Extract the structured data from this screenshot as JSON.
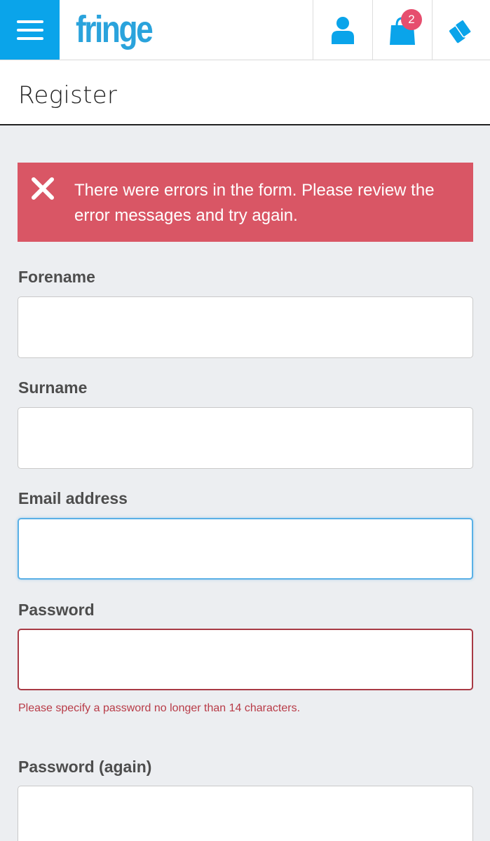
{
  "header": {
    "logo": "fringe",
    "basket_count": "2"
  },
  "icons": {
    "menu": "hamburger-menu-icon",
    "account": "user-icon",
    "basket": "shopping-bag-icon",
    "tickets": "tickets-icon",
    "alert": "close-x-icon"
  },
  "colors": {
    "brand_blue": "#0aa4ea",
    "alert_bg": "#d95665",
    "badge": "#e64e6e",
    "error_text": "#b83b47"
  },
  "page": {
    "title": "Register"
  },
  "alert": {
    "message": "There were errors in the form. Please review the error messages and try again."
  },
  "form": {
    "forename": {
      "label": "Forename",
      "value": ""
    },
    "surname": {
      "label": "Surname",
      "value": ""
    },
    "email": {
      "label": "Email address",
      "value": ""
    },
    "password": {
      "label": "Password",
      "value": "",
      "error": "Please specify a password no longer than 14 characters."
    },
    "password_again": {
      "label": "Password (again)",
      "value": ""
    }
  }
}
